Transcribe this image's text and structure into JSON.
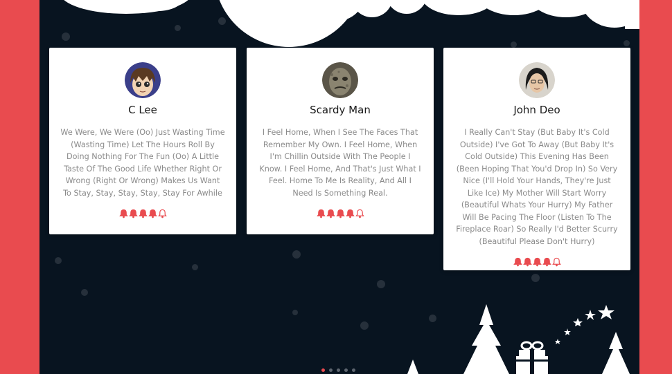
{
  "colors": {
    "frame": "#e94b4f",
    "background": "#081420",
    "card": "#ffffff",
    "accent": "#e94b4f"
  },
  "testimonials": [
    {
      "name": "C Lee",
      "avatar_icon": "anime-avatar-icon",
      "quote": "We Were, We Were (Oo) Just Wasting Time (Wasting Time) Let The Hours Roll By Doing Nothing For The Fun (Oo) A Little Taste Of The Good Life Whether Right Or Wrong (Right Or Wrong) Makes Us Want To Stay, Stay, Stay, Stay, Stay For Awhile",
      "rating": 4,
      "rating_max": 5
    },
    {
      "name": "Scardy Man",
      "avatar_icon": "scary-face-avatar-icon",
      "quote": "I Feel Home, When I See The Faces That Remember My Own. I Feel Home, When I'm Chillin Outside With The People I Know. I Feel Home, And That's Just What I Feel. Home To Me Is Reality, And All I Need Is Something Real.",
      "rating": 4,
      "rating_max": 5
    },
    {
      "name": "John Deo",
      "avatar_icon": "person-photo-avatar-icon",
      "quote": "I Really Can't Stay (But Baby It's Cold Outside) I've Got To Away (But Baby It's Cold Outside) This Evening Has Been (Been Hoping That You'd Drop In) So Very Nice (I'll Hold Your Hands, They're Just Like Ice) My Mother Will Start Worry (Beautiful Whats Your Hurry) My Father Will Be Pacing The Floor (Listen To The Fireplace Roar) So Really I'd Better Scurry (Beautiful Please Don't Hurry)",
      "rating": 4,
      "rating_max": 5
    }
  ],
  "pagination": {
    "count": 5,
    "active": 0
  }
}
